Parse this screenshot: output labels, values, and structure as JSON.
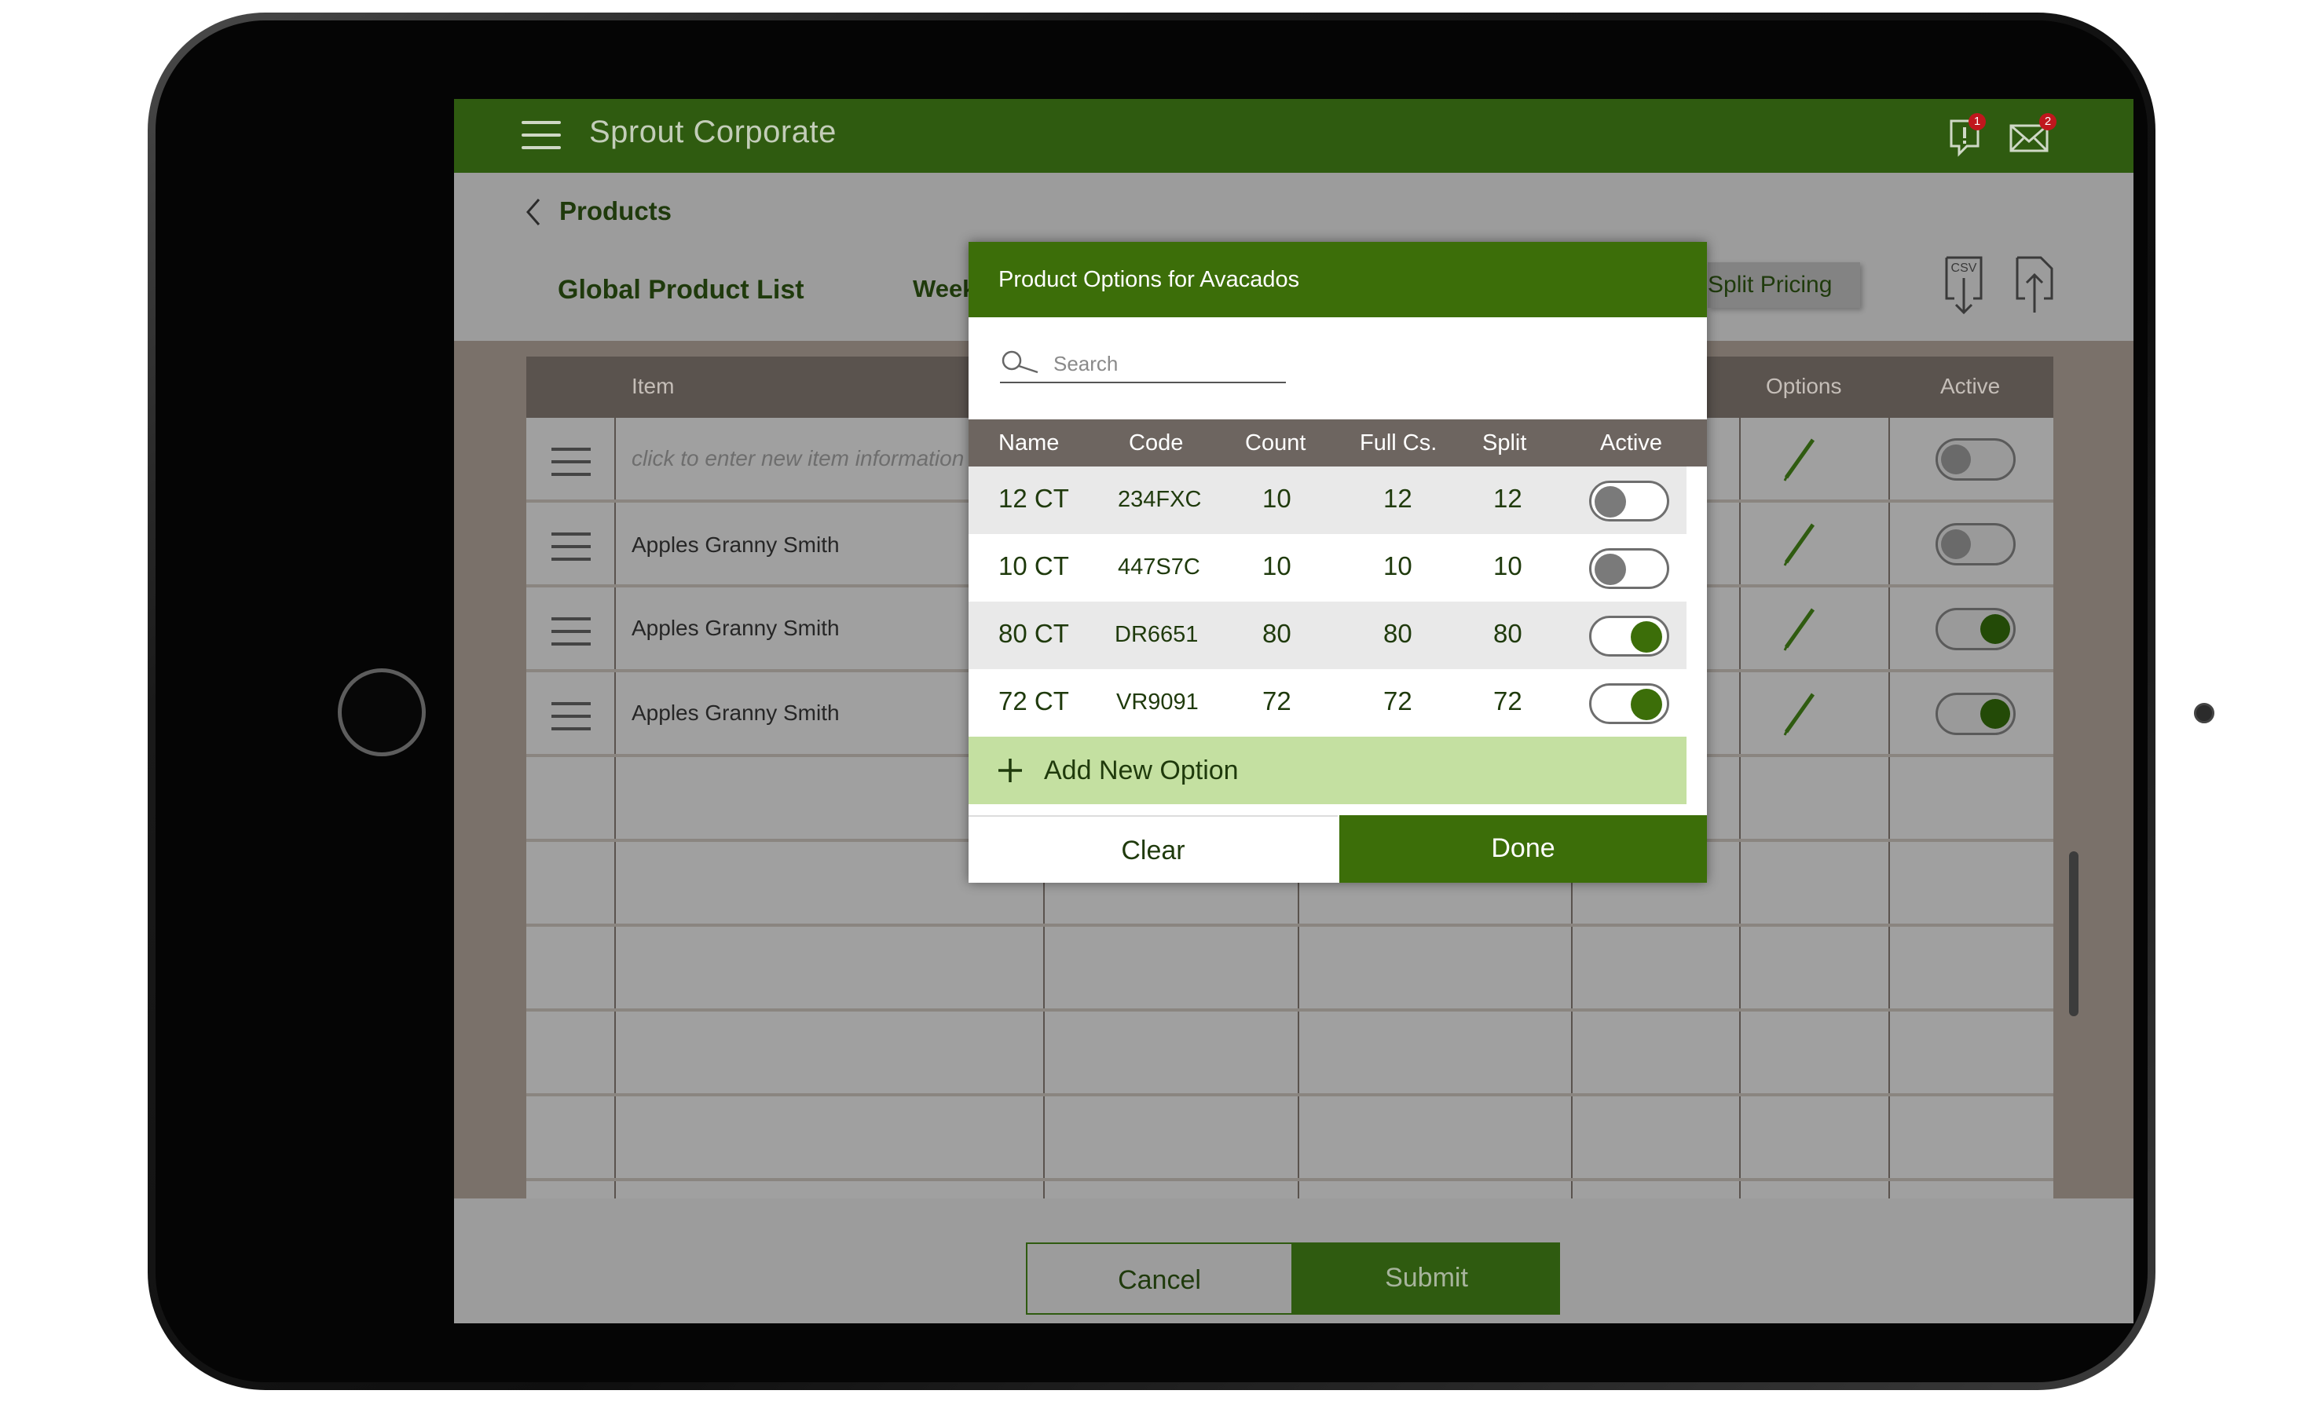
{
  "app": {
    "title": "Sprout Corporate",
    "alerts_badge": "1",
    "mail_badge": "2"
  },
  "subheader": {
    "back_label": "Products",
    "list_title": "Global Product List",
    "week_label": "Week",
    "split_pricing_label": "Split Pricing",
    "csv_label": "CSV"
  },
  "grid": {
    "headers": {
      "item": "Item",
      "options": "Options",
      "active": "Active"
    },
    "new_item_hint": "click to enter new item information",
    "rows": [
      {
        "name": "",
        "active": false
      },
      {
        "name": "Apples Granny Smith",
        "active": false
      },
      {
        "name": "Apples Granny Smith",
        "active": true
      },
      {
        "name": "Apples Granny Smith",
        "active": true
      }
    ]
  },
  "modal": {
    "title": "Product Options for Avacados",
    "search_placeholder": "Search",
    "columns": [
      "Name",
      "Code",
      "Count",
      "Full Cs.",
      "Split",
      "Active"
    ],
    "rows": [
      {
        "name": "12 CT",
        "code": "234FXC",
        "count": "10",
        "full_cs": "12",
        "split": "12",
        "active": false
      },
      {
        "name": "10 CT",
        "code": "447S7C",
        "count": "10",
        "full_cs": "10",
        "split": "10",
        "active": false
      },
      {
        "name": "80 CT",
        "code": "DR6651",
        "count": "80",
        "full_cs": "80",
        "split": "80",
        "active": true
      },
      {
        "name": "72 CT",
        "code": "VR9091",
        "count": "72",
        "full_cs": "72",
        "split": "72",
        "active": true
      }
    ],
    "add_option_label": "Add New Option",
    "clear_label": "Clear",
    "done_label": "Done"
  },
  "footer": {
    "cancel_label": "Cancel",
    "submit_label": "Submit"
  },
  "colors": {
    "brand_green": "#2f5b10",
    "modal_green": "#3c6e09",
    "add_option_bg": "#c4e0a1"
  }
}
